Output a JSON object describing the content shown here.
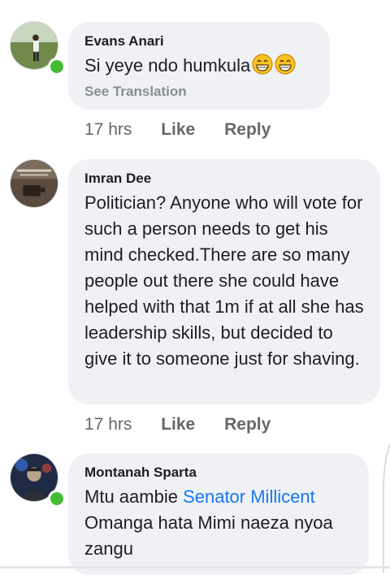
{
  "comments": [
    {
      "author": "Evans Anari",
      "text": "Si yeye ndo humkula",
      "emoji": [
        "grinning-face",
        "grinning-face"
      ],
      "see_translation": "See Translation",
      "time": "17 hrs",
      "like": "Like",
      "reply": "Reply",
      "online": true
    },
    {
      "author": "Imran Dee",
      "text": "Politician? Anyone who will vote for such a person needs to get his mind checked.There are so many people out there she could have helped with that 1m if at all she has leadership skills, but decided to give it to someone just for shaving.",
      "time": "17 hrs",
      "like": "Like",
      "reply": "Reply",
      "online": false
    },
    {
      "author": "Montanah Sparta",
      "text_before": "Mtu aambie ",
      "mention": "Senator Millicent",
      "text_after": " Omanga hata Mimi naeza nyoa zangu",
      "online": true
    }
  ],
  "colors": {
    "bubble": "#eff1f4",
    "mention": "#1877f2",
    "online": "#44bd32",
    "meta": "#65676b"
  }
}
